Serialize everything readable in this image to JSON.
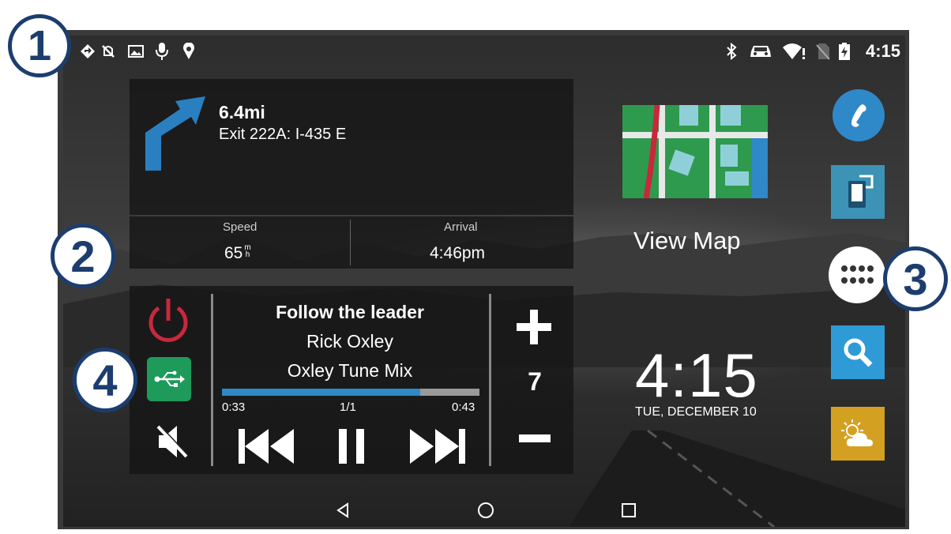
{
  "status_bar": {
    "left_icons": [
      "navigation-arrow-icon",
      "no-tracking-icon",
      "photo-icon",
      "microphone-icon",
      "location-pin-icon"
    ],
    "right_icons": [
      "bluetooth-icon",
      "car-icon",
      "wifi-alert-icon",
      "no-sim-icon",
      "battery-charging-icon"
    ],
    "time": "4:15"
  },
  "navigation": {
    "distance": "6.4mi",
    "instruction": "Exit 222A: I-435 E",
    "speed_label": "Speed",
    "speed_value": "65",
    "speed_unit_top": "m",
    "speed_unit_bottom": "h",
    "arrival_label": "Arrival",
    "arrival_value": "4:46pm"
  },
  "media": {
    "title": "Follow the leader",
    "artist": "Rick Oxley",
    "album": "Oxley Tune Mix",
    "progress_fraction": 0.77,
    "elapsed": "0:33",
    "track_position": "1/1",
    "duration": "0:43",
    "volume": "7"
  },
  "map_shortcut": {
    "label": "View Map"
  },
  "clock_widget": {
    "time": "4:15",
    "date": "TUE, DECEMBER 10"
  },
  "apps": [
    "phone-app-icon",
    "smartphone-link-app-icon",
    "app-drawer-icon",
    "search-app-icon",
    "weather-app-icon"
  ],
  "callouts": {
    "one": "1",
    "two": "2",
    "three": "3",
    "four": "4"
  },
  "colors": {
    "accent_blue": "#2f88c8",
    "power_red": "#c8283c",
    "usb_green": "#1e9a5a",
    "callout_navy": "#1c3d6e"
  }
}
